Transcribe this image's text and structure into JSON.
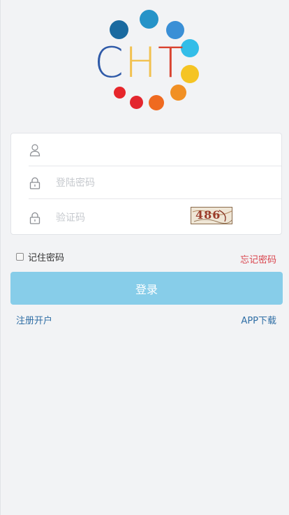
{
  "logo": {
    "letters": [
      {
        "char": "C",
        "color": "#2f5aa8"
      },
      {
        "char": "H",
        "color": "#f2c14f"
      },
      {
        "char": "T",
        "color": "#d9432f"
      }
    ],
    "dot_colors": [
      "#1a6aa0",
      "#2593c8",
      "#3a8fd6",
      "#33bde8",
      "#f5c423",
      "#f19024",
      "#ef6a20",
      "#e3262e",
      "#e6262b"
    ]
  },
  "form": {
    "username": {
      "value": "",
      "placeholder": "",
      "icon": "user-icon"
    },
    "password": {
      "value": "",
      "placeholder": "登陆密码",
      "icon": "lock-icon"
    },
    "captcha": {
      "value": "",
      "placeholder": "验证码",
      "icon": "lock-icon",
      "image_text": "486"
    }
  },
  "remember": {
    "label": "记住密码",
    "checked": false
  },
  "forgot_label": "忘记密码",
  "login_label": "登录",
  "register_label": "注册开户",
  "app_download_label": "APP下载",
  "colors": {
    "background": "#f2f3f5",
    "login_button": "#87cde9",
    "forgot_link": "#d9434c",
    "link": "#2f6ea5"
  }
}
